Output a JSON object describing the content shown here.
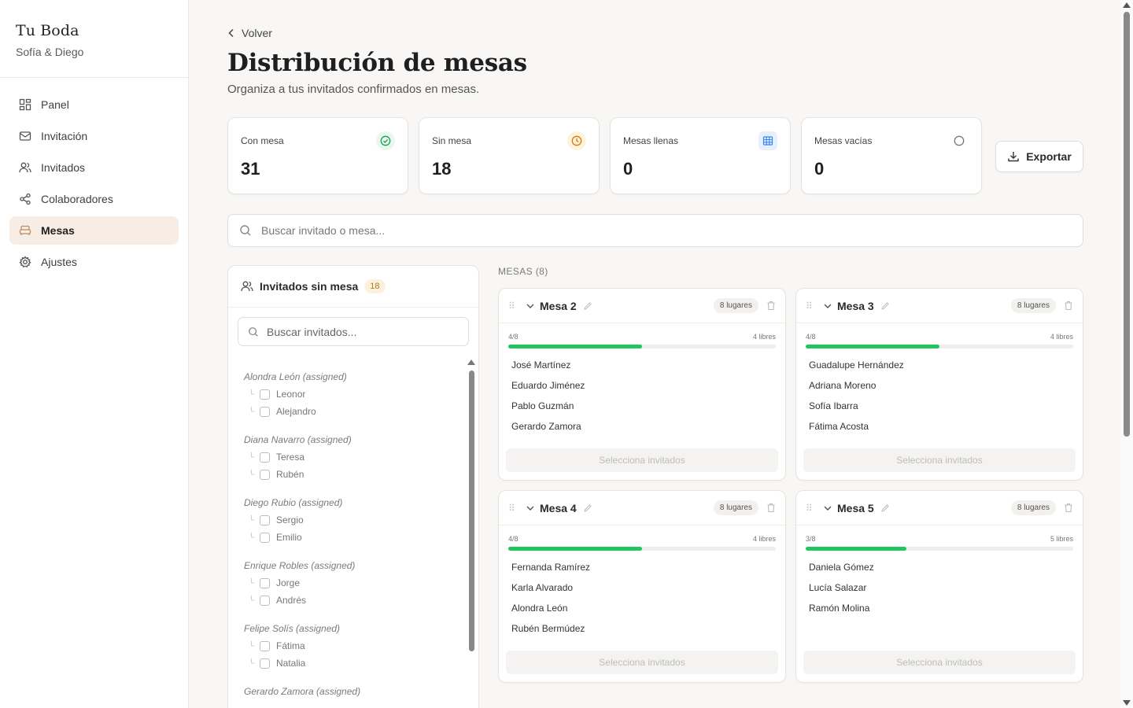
{
  "brand": {
    "title": "Tu Boda",
    "subtitle": "Sofía & Diego"
  },
  "nav": [
    {
      "label": "Panel",
      "icon": "dashboard-icon"
    },
    {
      "label": "Invitación",
      "icon": "mail-icon"
    },
    {
      "label": "Invitados",
      "icon": "users-icon"
    },
    {
      "label": "Colaboradores",
      "icon": "share-icon"
    },
    {
      "label": "Mesas",
      "icon": "sofa-icon",
      "active": true
    },
    {
      "label": "Ajustes",
      "icon": "gear-icon"
    }
  ],
  "header": {
    "back_label": "Volver",
    "title": "Distribución de mesas",
    "subtitle": "Organiza a tus invitados confirmados en mesas."
  },
  "stats": [
    {
      "label": "Con mesa",
      "value": "31",
      "icon": "check-circle-icon",
      "color": "#16a34a",
      "bg": "#e9f8ee"
    },
    {
      "label": "Sin mesa",
      "value": "18",
      "icon": "clock-icon",
      "color": "#d97706",
      "bg": "#fdf3df"
    },
    {
      "label": "Mesas llenas",
      "value": "0",
      "icon": "table-grid-icon",
      "color": "#3b82f6",
      "bg": "#e7f0fd"
    },
    {
      "label": "Mesas vacías",
      "value": "0",
      "icon": "circle-icon",
      "color": "#777777",
      "bg": "#ffffff"
    }
  ],
  "export_label": "Exportar",
  "search": {
    "placeholder": "Buscar invitado o mesa..."
  },
  "unassigned": {
    "title": "Invitados sin mesa",
    "count": "18",
    "search_placeholder": "Buscar invitados...",
    "groups": [
      {
        "title": "Alondra León (assigned)",
        "members": [
          "Leonor",
          "Alejandro"
        ]
      },
      {
        "title": "Diana Navarro (assigned)",
        "members": [
          "Teresa",
          "Rubén"
        ]
      },
      {
        "title": "Diego Rubio (assigned)",
        "members": [
          "Sergio",
          "Emilio"
        ]
      },
      {
        "title": "Enrique Robles (assigned)",
        "members": [
          "Jorge",
          "Andrés"
        ]
      },
      {
        "title": "Felipe Solís (assigned)",
        "members": [
          "Fátima",
          "Natalia"
        ]
      },
      {
        "title": "Gerardo Zamora (assigned)",
        "members": []
      }
    ]
  },
  "tables_label": "MESAS (8)",
  "tables": [
    {
      "name": "Mesa 2",
      "seats": "8 lugares",
      "occupancy": "4/8",
      "free": "4 libres",
      "fill": 0.5,
      "guests": [
        "José Martínez",
        "Eduardo Jiménez",
        "Pablo Guzmán",
        "Gerardo Zamora"
      ],
      "action": "Selecciona invitados"
    },
    {
      "name": "Mesa 3",
      "seats": "8 lugares",
      "occupancy": "4/8",
      "free": "4 libres",
      "fill": 0.5,
      "guests": [
        "Guadalupe Hernández",
        "Adriana Moreno",
        "Sofía Ibarra",
        "Fátima Acosta"
      ],
      "action": "Selecciona invitados"
    },
    {
      "name": "Mesa 4",
      "seats": "8 lugares",
      "occupancy": "4/8",
      "free": "4 libres",
      "fill": 0.5,
      "guests": [
        "Fernanda Ramírez",
        "Karla Alvarado",
        "Alondra León",
        "Rubén Bermúdez"
      ],
      "action": "Selecciona invitados"
    },
    {
      "name": "Mesa 5",
      "seats": "8 lugares",
      "occupancy": "3/8",
      "free": "5 libres",
      "fill": 0.375,
      "guests": [
        "Daniela Gómez",
        "Lucía Salazar",
        "Ramón Molina"
      ],
      "action": "Selecciona invitados"
    }
  ]
}
